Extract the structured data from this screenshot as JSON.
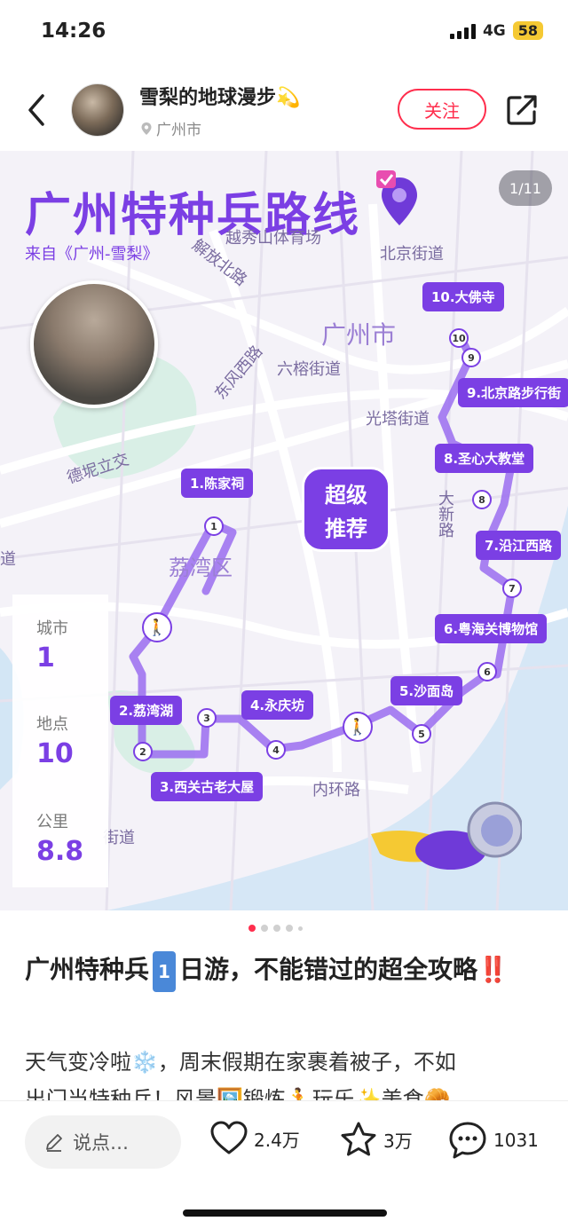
{
  "status": {
    "time": "14:26",
    "network": "4G",
    "battery": "58"
  },
  "author": {
    "name": "雪梨的地球漫步💫",
    "location": "广州市"
  },
  "header": {
    "follow_label": "关注"
  },
  "image": {
    "counter": "1/11",
    "title": "广州特种兵路线",
    "subtitle": "来自《广州-雪梨》",
    "city_big": "广州市",
    "district": "荔湾区",
    "places": [
      "越秀山体育场",
      "解放北路",
      "北京街道",
      "东风西路",
      "六榕街道",
      "光塔街道",
      "德坭立交",
      "大新路",
      "内环路",
      "街道",
      "道"
    ],
    "super_badge": [
      "超级",
      "推荐"
    ],
    "stops": [
      "1.陈家祠",
      "2.荔湾湖",
      "3.西关古老大屋",
      "4.永庆坊",
      "5.沙面岛",
      "6.粤海关博物馆",
      "7.沿江西路",
      "8.圣心大教堂",
      "9.北京路步行街",
      "10.大佛寺"
    ],
    "stop_numbers": [
      "1",
      "2",
      "3",
      "4",
      "5",
      "6",
      "7",
      "8",
      "9",
      "10"
    ],
    "stats": [
      {
        "label": "城市",
        "value": "1"
      },
      {
        "label": "地点",
        "value": "10"
      },
      {
        "label": "公里",
        "value": "8.8"
      }
    ]
  },
  "post": {
    "title_part1": "广州特种兵",
    "title_tag": "1",
    "title_part2": "日游，不能错过的超全攻略",
    "title_emoji": "‼️",
    "body_line1": "天气变冷啦❄️，周末假期在家裹着被子，不如",
    "body_line2": "出门当特种兵！风景🖼️锻炼🏃玩乐✨美食🥐"
  },
  "bottom": {
    "comment_placeholder": "说点…",
    "likes": "2.4万",
    "stars": "3万",
    "comments": "1031"
  },
  "colors": {
    "accent": "#7b3fe4",
    "follow": "#ff2e4d"
  }
}
